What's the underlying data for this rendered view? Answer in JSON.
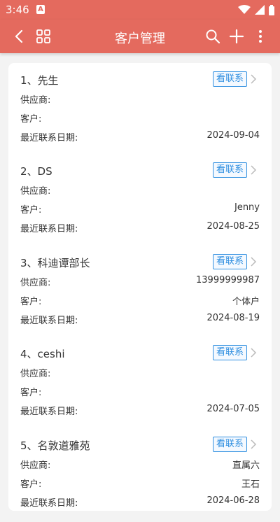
{
  "status_bar": {
    "time": "3:46",
    "app_badge": "A"
  },
  "app_bar": {
    "title": "客户管理"
  },
  "labels": {
    "supplier": "供应商:",
    "customer": "客户:",
    "last_contact": "最近联系日期:"
  },
  "contact_button_label": "看联系",
  "customers": [
    {
      "name": "1、先生",
      "supplier": "",
      "customer": "",
      "last_contact": "2024-09-04"
    },
    {
      "name": "2、DS",
      "supplier": "",
      "customer": "Jenny",
      "last_contact": "2024-08-25"
    },
    {
      "name": "3、科迪谭部长",
      "supplier": "13999999987",
      "customer": "个体户",
      "last_contact": "2024-08-19"
    },
    {
      "name": "4、ceshi",
      "supplier": "",
      "customer": "",
      "last_contact": "2024-07-05"
    },
    {
      "name": "5、名敦道雅苑",
      "supplier": "直属六",
      "customer": "王石",
      "last_contact": "2024-06-28"
    }
  ],
  "colors": {
    "brand": "#e46a5e",
    "link": "#2f8fe0"
  }
}
